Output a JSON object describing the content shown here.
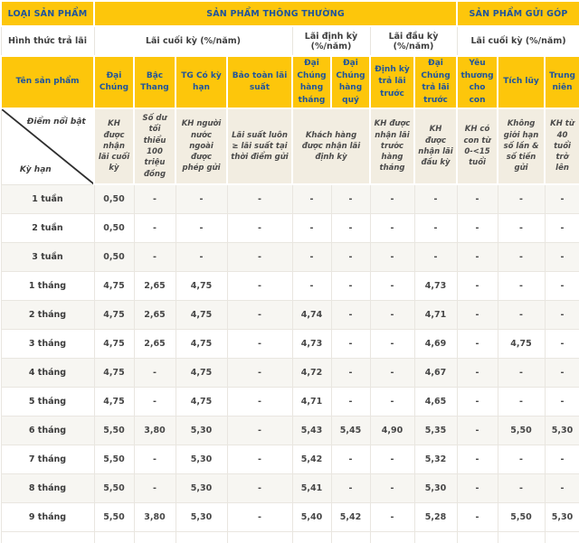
{
  "table": {
    "top_headers": [
      {
        "label": "LOẠI SẢN PHẨM",
        "colspan": 1
      },
      {
        "label": "SẢN PHẨM THÔNG THƯỜNG",
        "colspan": 8
      },
      {
        "label": "SẢN PHẨM GỬI GÓP",
        "colspan": 3
      }
    ],
    "payment_row": {
      "label": "Hình thức trả lãi",
      "groups": [
        {
          "label": "Lãi cuối kỳ (%/năm)",
          "colspan": 4
        },
        {
          "label": "Lãi định kỳ (%/năm)",
          "colspan": 2
        },
        {
          "label": "Lãi đầu kỳ (%/năm)",
          "colspan": 2
        },
        {
          "label": "Lãi cuối kỳ (%/năm)",
          "colspan": 3
        }
      ]
    },
    "product_row": {
      "label": "Tên sản phẩm",
      "products": [
        "Đại Chúng",
        "Bậc Thang",
        "TG Có kỳ hạn",
        "Bảo toàn lãi suất",
        "Đại Chúng hàng tháng",
        "Đại Chúng hàng quý",
        "Định kỳ trả lãi trước",
        "Đại Chúng trả lãi trước",
        "Yêu thương cho con",
        "Tích lũy",
        "Trung niên"
      ]
    },
    "highlight_row": {
      "corner_top": "Điểm nổi bật",
      "corner_bottom": "Kỳ hạn",
      "highlights": [
        {
          "text": "KH được nhận lãi cuối kỳ",
          "colspan": 1
        },
        {
          "text": "Số dư tối thiểu 100 triệu đồng",
          "colspan": 1
        },
        {
          "text": "KH người nước ngoài được phép gửi",
          "colspan": 1
        },
        {
          "text": "Lãi suất luôn ≥ lãi suất tại thời điểm gửi",
          "colspan": 1
        },
        {
          "text": "Khách hàng được nhận lãi định kỳ",
          "colspan": 2
        },
        {
          "text": "KH được nhận lãi trước hàng tháng",
          "colspan": 1
        },
        {
          "text": "KH được nhận lãi đầu kỳ",
          "colspan": 1
        },
        {
          "text": "KH có con từ 0-<15 tuổi",
          "colspan": 1
        },
        {
          "text": "Không giới hạn số lần & số tiền gửi",
          "colspan": 1
        },
        {
          "text": "KH từ 40 tuổi trở lên",
          "colspan": 1
        }
      ]
    },
    "rows": [
      {
        "term": "1 tuần",
        "values": [
          "0,50",
          "-",
          "-",
          "-",
          "-",
          "-",
          "-",
          "-",
          "-",
          "-",
          "-"
        ]
      },
      {
        "term": "2 tuần",
        "values": [
          "0,50",
          "-",
          "-",
          "-",
          "-",
          "-",
          "-",
          "-",
          "-",
          "-",
          "-"
        ]
      },
      {
        "term": "3 tuần",
        "values": [
          "0,50",
          "-",
          "-",
          "-",
          "-",
          "-",
          "-",
          "-",
          "-",
          "-",
          "-"
        ]
      },
      {
        "term": "1 tháng",
        "values": [
          "4,75",
          "2,65",
          "4,75",
          "-",
          "-",
          "-",
          "-",
          "4,73",
          "-",
          "-",
          "-"
        ]
      },
      {
        "term": "2 tháng",
        "values": [
          "4,75",
          "2,65",
          "4,75",
          "-",
          "4,74",
          "-",
          "-",
          "4,71",
          "-",
          "-",
          "-"
        ]
      },
      {
        "term": "3 tháng",
        "values": [
          "4,75",
          "2,65",
          "4,75",
          "-",
          "4,73",
          "-",
          "-",
          "4,69",
          "-",
          "4,75",
          "-"
        ]
      },
      {
        "term": "4 tháng",
        "values": [
          "4,75",
          "-",
          "4,75",
          "-",
          "4,72",
          "-",
          "-",
          "4,67",
          "-",
          "-",
          "-"
        ]
      },
      {
        "term": "5 tháng",
        "values": [
          "4,75",
          "-",
          "4,75",
          "-",
          "4,71",
          "-",
          "-",
          "4,65",
          "-",
          "-",
          "-"
        ]
      },
      {
        "term": "6 tháng",
        "values": [
          "5,50",
          "3,80",
          "5,30",
          "-",
          "5,43",
          "5,45",
          "4,90",
          "5,35",
          "-",
          "5,50",
          "5,30"
        ]
      },
      {
        "term": "7 tháng",
        "values": [
          "5,50",
          "-",
          "5,30",
          "-",
          "5,42",
          "-",
          "-",
          "5,32",
          "-",
          "-",
          "-"
        ]
      },
      {
        "term": "8 tháng",
        "values": [
          "5,50",
          "-",
          "5,30",
          "-",
          "5,41",
          "-",
          "-",
          "5,30",
          "-",
          "-",
          "-"
        ]
      },
      {
        "term": "9 tháng",
        "values": [
          "5,50",
          "3,80",
          "5,30",
          "-",
          "5,40",
          "5,42",
          "-",
          "5,28",
          "-",
          "5,50",
          "5,30"
        ]
      }
    ],
    "colors": {
      "header_yellow": "#fdc60b",
      "header_blue_text": "#1e549c",
      "highlight_cream": "#f2ede1",
      "alt_row": "#f7f6f2"
    }
  }
}
